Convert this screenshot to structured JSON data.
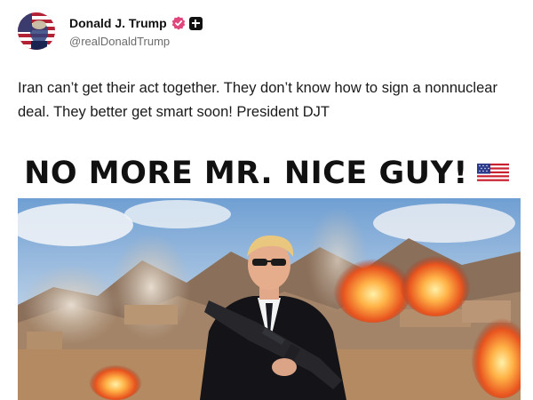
{
  "post": {
    "author": {
      "display_name": "Donald J. Trump",
      "handle": "@realDonaldTrump",
      "avatar_icon": "flag-portrait-avatar",
      "verified_icon": "verified-badge-icon",
      "verified_color": "#e0457b",
      "extra_badge_icon": "plus-badge-icon"
    },
    "text": "Iran can’t get their act together. They don’t know how to sign a nonnuclear deal. They better get smart soon! President DJT",
    "media": {
      "headline": "NO MORE MR. NICE GUY!",
      "headline_icon": "us-flag-emoji-icon",
      "photo_description_icon": "man-with-rifle-explosions-photo"
    }
  }
}
